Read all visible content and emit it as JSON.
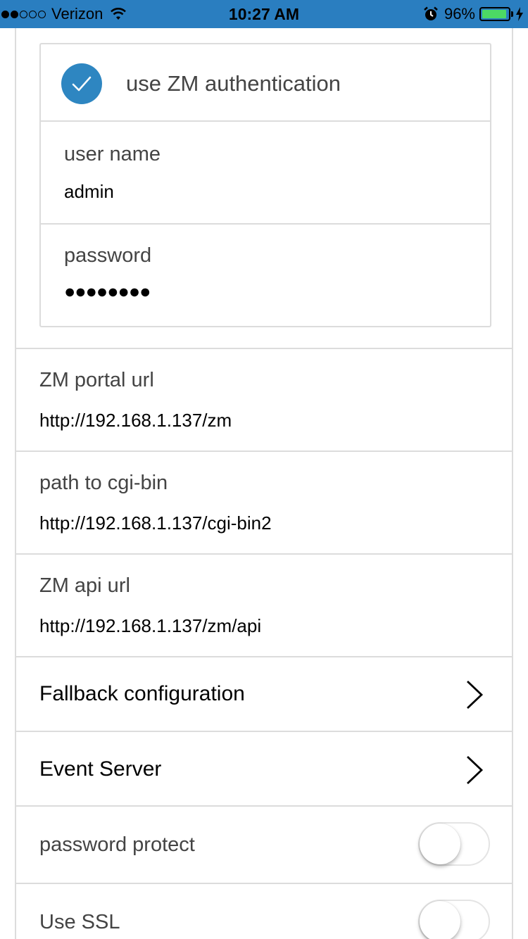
{
  "status_bar": {
    "carrier": "Verizon",
    "time": "10:27 AM",
    "battery_percent": "96%",
    "battery_level": 0.96,
    "signal_bars_filled": 2,
    "signal_bars_total": 5
  },
  "auth": {
    "label": "use ZM authentication",
    "checked": true,
    "username_label": "user name",
    "username_value": "admin",
    "password_label": "password",
    "password_value": "●●●●●●●●"
  },
  "portal": {
    "label": "ZM portal url",
    "value": "http://192.168.1.137/zm"
  },
  "cgi": {
    "label": "path to cgi-bin",
    "value": "http://192.168.1.137/cgi-bin2"
  },
  "api": {
    "label": "ZM api url",
    "value": "http://192.168.1.137/zm/api"
  },
  "fallback": {
    "label": "Fallback configuration"
  },
  "event_server": {
    "label": "Event Server"
  },
  "password_protect": {
    "label": "password protect",
    "enabled": false
  },
  "use_ssl": {
    "label": "Use SSL",
    "enabled": false
  },
  "colors": {
    "status_bar_bg": "#2a7ec0",
    "checkbox_accent": "#2e86c1",
    "battery_fill": "#4cd964",
    "divider": "#dcdcdc"
  },
  "icons": [
    "wifi-icon",
    "alarm-icon",
    "battery-icon",
    "charging-bolt-icon",
    "checkmark-icon",
    "chevron-right-icon"
  ]
}
